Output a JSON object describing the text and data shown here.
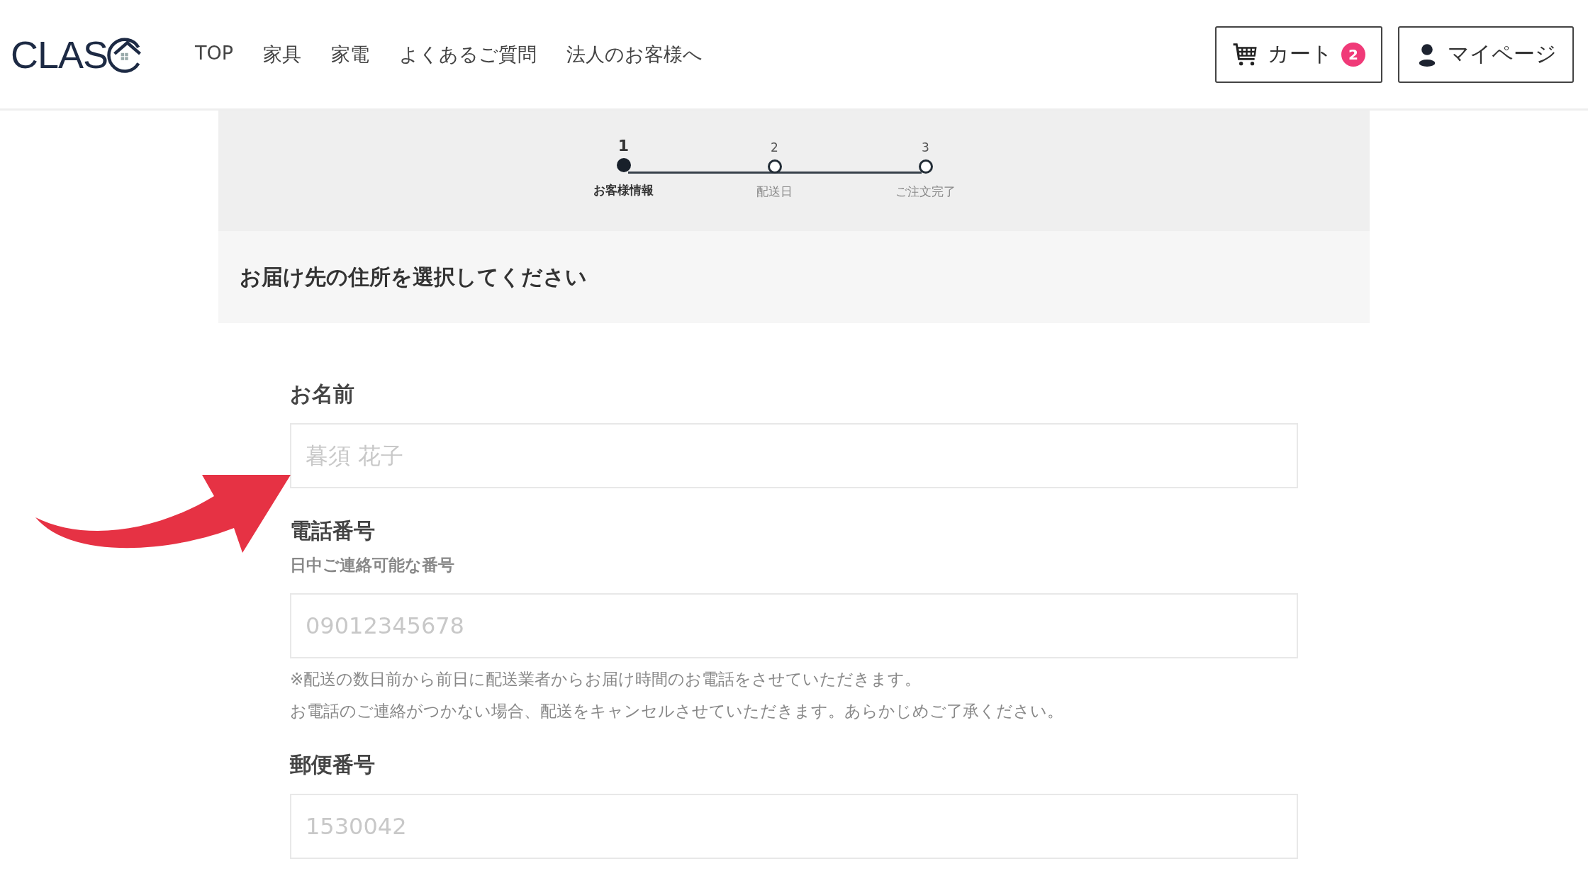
{
  "header": {
    "logo": "CLAS",
    "nav": [
      "TOP",
      "家具",
      "家電",
      "よくあるご質問",
      "法人のお客様へ"
    ],
    "cart": {
      "label": "カート",
      "count": "2"
    },
    "mypage": {
      "label": "マイページ"
    }
  },
  "stepper": [
    {
      "number": "1",
      "label": "お客様情報",
      "selected": true
    },
    {
      "number": "2",
      "label": "配送日",
      "selected": false
    },
    {
      "number": "3",
      "label": "ご注文完了",
      "selected": false
    }
  ],
  "section_title": "お届け先の住所を選択してください",
  "fields": [
    {
      "label": "お名前",
      "placeholder": "暮須 花子"
    },
    {
      "label": "電話番号",
      "hint": "日中ご連絡可能な番号",
      "placeholder": "09012345678",
      "notes": [
        "※配送の数日前から前日に配送業者からお届け時間のお電話をさせていただきます。",
        "お電話のご連絡がつかない場合、配送をキャンセルさせていただきます。あらかじめご了承ください。"
      ]
    },
    {
      "label": "郵便番号",
      "placeholder": "1530042"
    }
  ]
}
